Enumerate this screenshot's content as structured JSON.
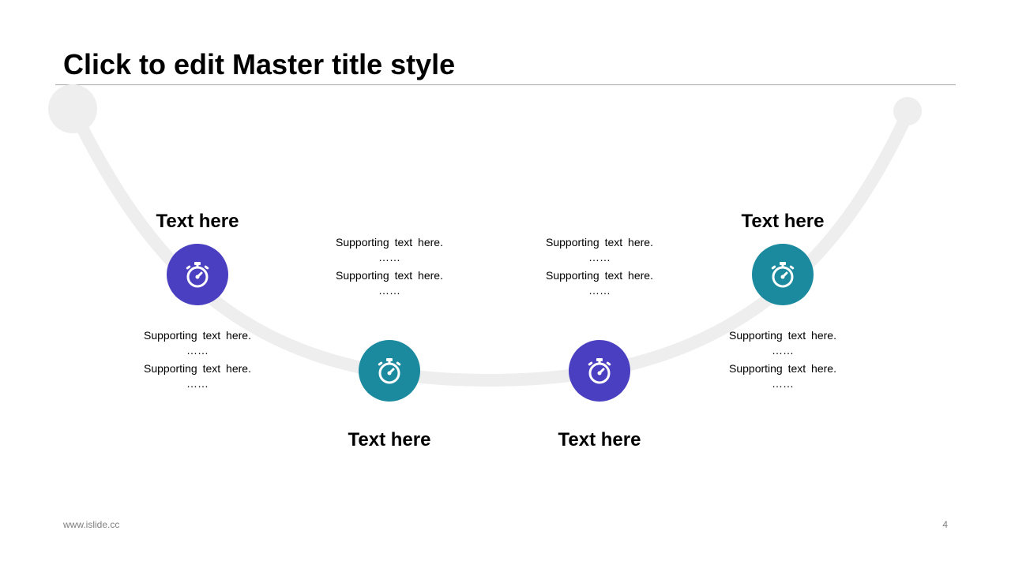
{
  "slide": {
    "title": "Click to edit Master title style",
    "footer_left": "www.islide.cc",
    "page_number": "4"
  },
  "colors": {
    "purple": "#4a3fc0",
    "teal": "#1b8a9e",
    "arc": "#eeeeee",
    "rule": "#a6a6a6"
  },
  "steps": [
    {
      "heading": "Text here",
      "icon": "stopwatch-icon",
      "color": "#4a3fc0",
      "supporting": [
        "Supporting text here.",
        "……",
        "Supporting text here.",
        "……"
      ]
    },
    {
      "heading": "Text here",
      "icon": "stopwatch-icon",
      "color": "#1b8a9e",
      "supporting": [
        "Supporting text here.",
        "……",
        "Supporting text here.",
        "……"
      ]
    },
    {
      "heading": "Text here",
      "icon": "stopwatch-icon",
      "color": "#4a3fc0",
      "supporting": [
        "Supporting text here.",
        "……",
        "Supporting text here.",
        "……"
      ]
    },
    {
      "heading": "Text here",
      "icon": "stopwatch-icon",
      "color": "#1b8a9e",
      "supporting": [
        "Supporting text here.",
        "……",
        "Supporting text here.",
        "……"
      ]
    }
  ]
}
